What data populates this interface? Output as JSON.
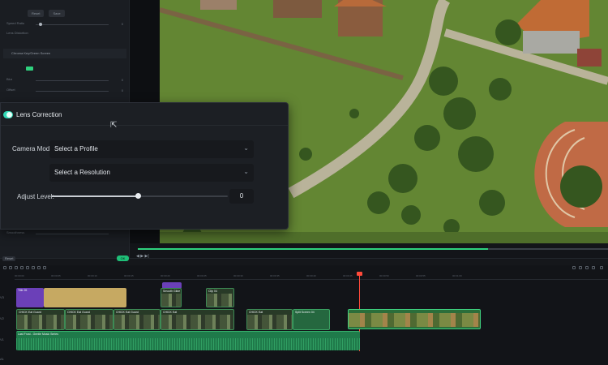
{
  "left_panel": {
    "top_buttons": [
      "Reset",
      "Save"
    ],
    "rows": [
      {
        "label": "Speed Ratio",
        "value": "0"
      },
      {
        "label": "Lens Distortion",
        "value": "0"
      },
      {
        "label": "Blur",
        "value": "0"
      },
      {
        "label": "Offset",
        "value": "0"
      },
      {
        "label": "Smoothness",
        "value": "0"
      }
    ],
    "section_title": "Chroma Key/Green Screen",
    "toggle_color": "#2fd27e"
  },
  "lens_correction": {
    "title": "Lens Correction",
    "enabled": true,
    "camera_model_label": "Camera Model:",
    "camera_model_value": "Select a Profile",
    "resolution_value": "Select a Resolution",
    "adjust_level_label": "Adjust Level:",
    "adjust_level_value": "0",
    "adjust_level_fraction": 0.49,
    "accent_color": "#31d8b6"
  },
  "player": {
    "progress_fraction": 0.73,
    "controls": "◀ ▶ ▶|"
  },
  "toolbar": {
    "left_button": "Reset",
    "ok_button": "OK"
  },
  "timeline": {
    "ruler_ticks": [
      "00:00:00",
      "00:00:05",
      "00:00:10",
      "00:00:15",
      "00:00:20",
      "00:00:25",
      "00:00:30",
      "00:00:35",
      "00:00:40",
      "00:00:45",
      "00:00:50",
      "00:00:55",
      "00:01:00"
    ],
    "track_icons": [
      "V3",
      "V2",
      "V1",
      "A1"
    ],
    "clips": {
      "title_clip": "Title 26",
      "yellow_clip": "",
      "effect_clip": "Smooth Glide",
      "v3_right_clip": "Clip 04",
      "v2_a": "CHICK Eat Guard",
      "v2_b": "CHICK Eat Guard",
      "v2_c": "CHICK Eat Guard",
      "v2_d": "CHICK Eat",
      "v2_e": "Split Screen 04",
      "v2_selected": "",
      "audio_clip": "Last Frost - Gentle Music Series"
    },
    "playhead_color": "#ff4a3a"
  }
}
